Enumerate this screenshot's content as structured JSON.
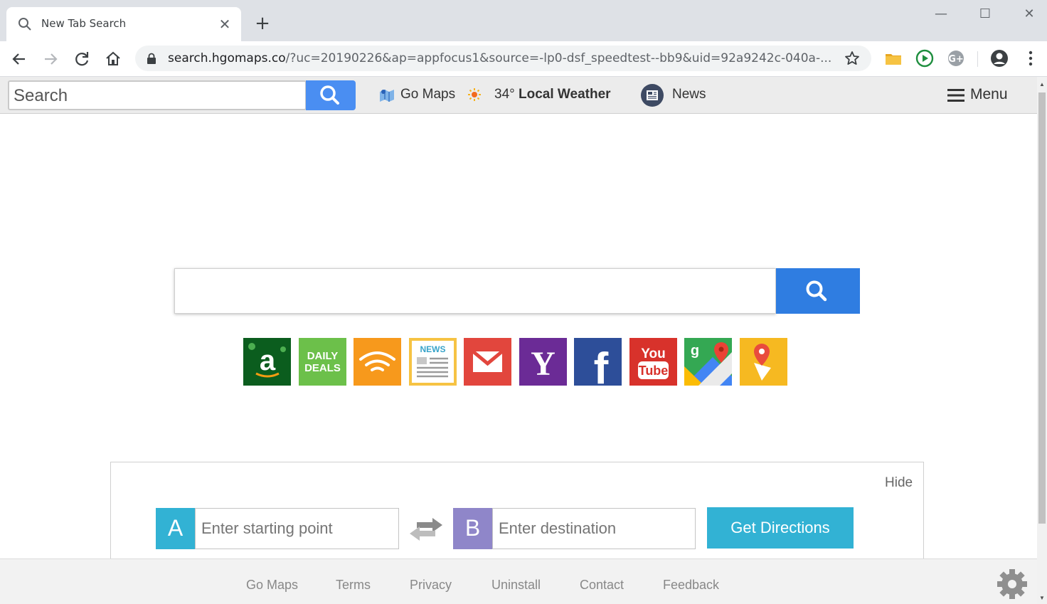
{
  "browser": {
    "tab_title": "New Tab Search",
    "new_tab_label": "+",
    "window_controls": {
      "minimize": "—",
      "maximize": "☐",
      "close": "✕"
    },
    "url_host": "search.hgomaps.co",
    "url_rest": "/?uc=20190226&ap=appfocus1&source=-lp0-dsf_speedtest--bb9&uid=92a9242c-040a-..."
  },
  "header": {
    "search_placeholder": "Search",
    "go_maps_label": "Go Maps",
    "temperature": "34°",
    "weather_label": "Local Weather",
    "news_label": "News",
    "menu_label": "Menu"
  },
  "main": {
    "search_placeholder": "",
    "tiles": [
      {
        "name": "amazon",
        "label": "a"
      },
      {
        "name": "daily-deals",
        "label": "DAILY DEALS"
      },
      {
        "name": "audible",
        "label": ""
      },
      {
        "name": "news",
        "label": "NEWS"
      },
      {
        "name": "gmail",
        "label": ""
      },
      {
        "name": "yahoo",
        "label": "Y"
      },
      {
        "name": "facebook",
        "label": "f"
      },
      {
        "name": "youtube",
        "label": "You Tube"
      },
      {
        "name": "google-maps",
        "label": "g"
      },
      {
        "name": "maps-directions",
        "label": ""
      }
    ]
  },
  "directions": {
    "hide_label": "Hide",
    "point_a": "A",
    "point_b": "B",
    "start_placeholder": "Enter starting point",
    "destination_placeholder": "Enter destination",
    "get_directions_label": "Get Directions"
  },
  "footer": {
    "links": [
      "Go Maps",
      "Terms",
      "Privacy",
      "Uninstall",
      "Contact",
      "Feedback"
    ]
  },
  "colors": {
    "accent_blue": "#2f7de1",
    "directions_cyan": "#32b2d4",
    "pin_a": "#32b2d4",
    "pin_b": "#8f86c9"
  }
}
